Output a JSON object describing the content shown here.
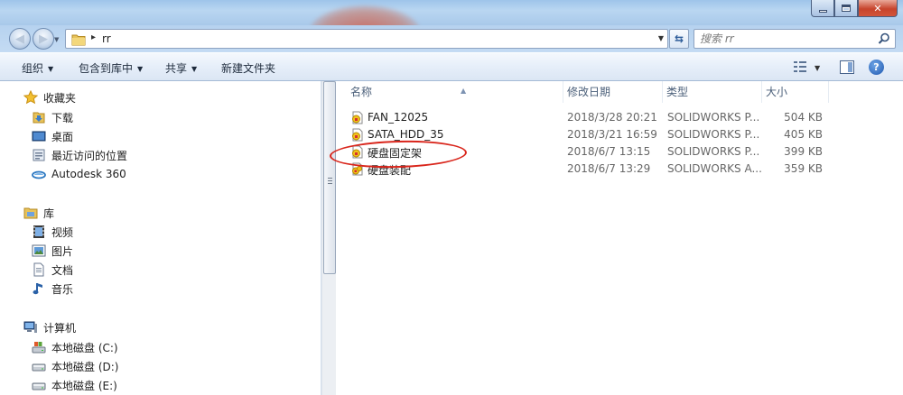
{
  "window": {
    "min_glyph": "—",
    "max_glyph": "□",
    "close_glyph": "✕"
  },
  "address": {
    "folder": "rr",
    "separator": "▸"
  },
  "search": {
    "placeholder": "搜索 rr"
  },
  "toolbar": {
    "organize": "组织",
    "include_in_library": "包含到库中",
    "share": "共享",
    "new_folder": "新建文件夹",
    "help_glyph": "?"
  },
  "navigation": {
    "favorites": {
      "label": "收藏夹",
      "items": [
        {
          "label": "下载",
          "icon": "download-folder-icon"
        },
        {
          "label": "桌面",
          "icon": "desktop-icon"
        },
        {
          "label": "最近访问的位置",
          "icon": "recent-places-icon"
        },
        {
          "label": "Autodesk 360",
          "icon": "autodesk-360-icon"
        }
      ]
    },
    "libraries": {
      "label": "库",
      "items": [
        {
          "label": "视频",
          "icon": "video-library-icon"
        },
        {
          "label": "图片",
          "icon": "pictures-library-icon"
        },
        {
          "label": "文档",
          "icon": "documents-library-icon"
        },
        {
          "label": "音乐",
          "icon": "music-library-icon"
        }
      ]
    },
    "computer": {
      "label": "计算机",
      "items": [
        {
          "label": "本地磁盘 (C:)",
          "icon": "system-drive-icon"
        },
        {
          "label": "本地磁盘 (D:)",
          "icon": "drive-icon"
        },
        {
          "label": "本地磁盘 (E:)",
          "icon": "drive-icon"
        }
      ]
    }
  },
  "columns": {
    "name": "名称",
    "modified": "修改日期",
    "type": "类型",
    "size": "大小"
  },
  "files": [
    {
      "name": "FAN_12025",
      "modified": "2018/3/28 20:21",
      "type": "SOLIDWORKS P...",
      "size": "504 KB",
      "icon": "solidworks-part-icon"
    },
    {
      "name": "SATA_HDD_35",
      "modified": "2018/3/21 16:59",
      "type": "SOLIDWORKS P...",
      "size": "405 KB",
      "icon": "solidworks-part-icon"
    },
    {
      "name": "硬盘固定架",
      "modified": "2018/6/7 13:15",
      "type": "SOLIDWORKS P...",
      "size": "399 KB",
      "icon": "solidworks-part-icon"
    },
    {
      "name": "硬盘装配",
      "modified": "2018/6/7 13:29",
      "type": "SOLIDWORKS A...",
      "size": "359 KB",
      "icon": "solidworks-assembly-icon"
    }
  ],
  "annotation": {
    "highlighted_file": "硬盘固定架",
    "color": "#d9261c"
  }
}
